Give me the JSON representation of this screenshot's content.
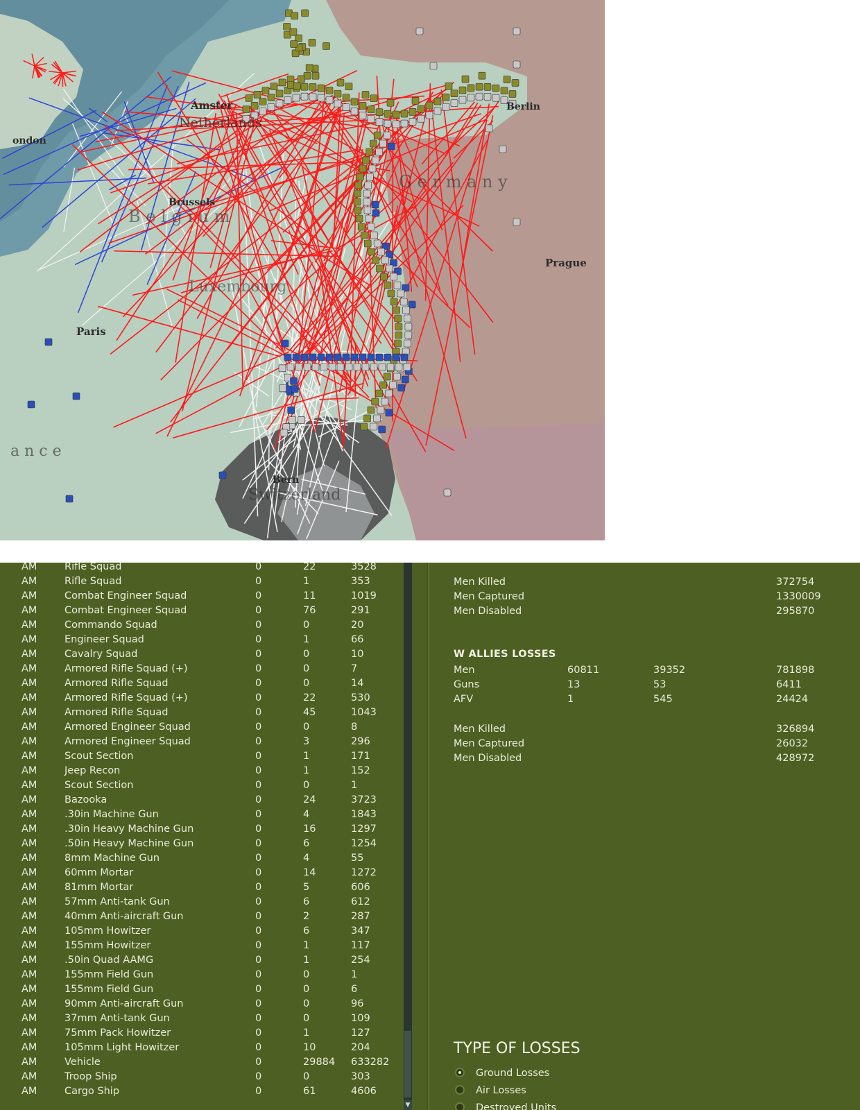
{
  "map": {
    "labels": {
      "amsterdam": "Amster",
      "netherlands": "Netherlands",
      "london": "ondon",
      "berlin": "Berlin",
      "germany": "G e r m a n y",
      "brussels": "Brussels",
      "belgium": "B e l g i u m",
      "prague": "Prague",
      "luxembourg": "Luxembourg",
      "paris": "Paris",
      "france": "a n c e",
      "bern": "Bern",
      "switzerland": "Switzerland"
    },
    "colors": {
      "sea": "#6f9aa8",
      "land_west": "#b9cfc0",
      "land_germany": "#b69a92",
      "switzerland": "#5a5c5c",
      "attack_line": "#ff1a1a",
      "white_line": "#f2f2f2",
      "blue_line": "#2f44d8",
      "allied_unit": "#8a8a2a",
      "axis_unit": "#c8c8c8",
      "blue_unit": "#2a4fb8"
    }
  },
  "units_table": {
    "rows": [
      {
        "nation": "AM",
        "name": "Rifle Squad",
        "a": "0",
        "b": "22",
        "c": "3528"
      },
      {
        "nation": "AM",
        "name": "Rifle Squad",
        "a": "0",
        "b": "1",
        "c": "353"
      },
      {
        "nation": "AM",
        "name": "Combat Engineer Squad",
        "a": "0",
        "b": "11",
        "c": "1019"
      },
      {
        "nation": "AM",
        "name": "Combat Engineer Squad",
        "a": "0",
        "b": "76",
        "c": "291"
      },
      {
        "nation": "AM",
        "name": "Commando Squad",
        "a": "0",
        "b": "0",
        "c": "20"
      },
      {
        "nation": "AM",
        "name": "Engineer Squad",
        "a": "0",
        "b": "1",
        "c": "66"
      },
      {
        "nation": "AM",
        "name": "Cavalry Squad",
        "a": "0",
        "b": "0",
        "c": "10"
      },
      {
        "nation": "AM",
        "name": "Armored Rifle Squad (+)",
        "a": "0",
        "b": "0",
        "c": "7"
      },
      {
        "nation": "AM",
        "name": "Armored Rifle Squad",
        "a": "0",
        "b": "0",
        "c": "14"
      },
      {
        "nation": "AM",
        "name": "Armored Rifle Squad (+)",
        "a": "0",
        "b": "22",
        "c": "530"
      },
      {
        "nation": "AM",
        "name": "Armored Rifle Squad",
        "a": "0",
        "b": "45",
        "c": "1043"
      },
      {
        "nation": "AM",
        "name": "Armored Engineer Squad",
        "a": "0",
        "b": "0",
        "c": "8"
      },
      {
        "nation": "AM",
        "name": "Armored Engineer Squad",
        "a": "0",
        "b": "3",
        "c": "296"
      },
      {
        "nation": "AM",
        "name": "Scout Section",
        "a": "0",
        "b": "1",
        "c": "171"
      },
      {
        "nation": "AM",
        "name": "Jeep Recon",
        "a": "0",
        "b": "1",
        "c": "152"
      },
      {
        "nation": "AM",
        "name": "Scout Section",
        "a": "0",
        "b": "0",
        "c": "1"
      },
      {
        "nation": "AM",
        "name": "Bazooka",
        "a": "0",
        "b": "24",
        "c": "3723"
      },
      {
        "nation": "AM",
        "name": ".30in Machine Gun",
        "a": "0",
        "b": "4",
        "c": "1843"
      },
      {
        "nation": "AM",
        "name": ".30in Heavy Machine Gun",
        "a": "0",
        "b": "16",
        "c": "1297"
      },
      {
        "nation": "AM",
        "name": ".50in Heavy Machine Gun",
        "a": "0",
        "b": "6",
        "c": "1254"
      },
      {
        "nation": "AM",
        "name": "8mm Machine Gun",
        "a": "0",
        "b": "4",
        "c": "55"
      },
      {
        "nation": "AM",
        "name": "60mm Mortar",
        "a": "0",
        "b": "14",
        "c": "1272"
      },
      {
        "nation": "AM",
        "name": "81mm Mortar",
        "a": "0",
        "b": "5",
        "c": "606"
      },
      {
        "nation": "AM",
        "name": "57mm Anti-tank Gun",
        "a": "0",
        "b": "6",
        "c": "612"
      },
      {
        "nation": "AM",
        "name": "40mm Anti-aircraft Gun",
        "a": "0",
        "b": "2",
        "c": "287"
      },
      {
        "nation": "AM",
        "name": "105mm Howitzer",
        "a": "0",
        "b": "6",
        "c": "347"
      },
      {
        "nation": "AM",
        "name": "155mm Howitzer",
        "a": "0",
        "b": "1",
        "c": "117"
      },
      {
        "nation": "AM",
        "name": ".50in Quad AAMG",
        "a": "0",
        "b": "1",
        "c": "254"
      },
      {
        "nation": "AM",
        "name": "155mm Field Gun",
        "a": "0",
        "b": "0",
        "c": "1"
      },
      {
        "nation": "AM",
        "name": "155mm Field Gun",
        "a": "0",
        "b": "0",
        "c": "6"
      },
      {
        "nation": "AM",
        "name": "90mm Anti-aircraft Gun",
        "a": "0",
        "b": "0",
        "c": "96"
      },
      {
        "nation": "AM",
        "name": "37mm Anti-tank Gun",
        "a": "0",
        "b": "0",
        "c": "109"
      },
      {
        "nation": "AM",
        "name": "75mm Pack Howitzer",
        "a": "0",
        "b": "1",
        "c": "127"
      },
      {
        "nation": "AM",
        "name": "105mm Light Howitzer",
        "a": "0",
        "b": "10",
        "c": "204"
      },
      {
        "nation": "AM",
        "name": "Vehicle",
        "a": "0",
        "b": "29884",
        "c": "633282"
      },
      {
        "nation": "AM",
        "name": "Troop Ship",
        "a": "0",
        "b": "0",
        "c": "303"
      },
      {
        "nation": "AM",
        "name": "Cargo Ship",
        "a": "0",
        "b": "61",
        "c": "4606"
      }
    ]
  },
  "axis_summary": {
    "men_killed_label": "Men Killed",
    "men_killed": "372754",
    "men_captured_label": "Men Captured",
    "men_captured": "1330009",
    "men_disabled_label": "Men Disabled",
    "men_disabled": "295870"
  },
  "wallies": {
    "title": "W ALLIES LOSSES",
    "rows": [
      {
        "label": "Men",
        "v1": "60811",
        "v2": "39352",
        "v3": "781898"
      },
      {
        "label": "Guns",
        "v1": "13",
        "v2": "53",
        "v3": "6411"
      },
      {
        "label": "AFV",
        "v1": "1",
        "v2": "545",
        "v3": "24424"
      }
    ],
    "men_killed_label": "Men Killed",
    "men_killed": "326894",
    "men_captured_label": "Men Captured",
    "men_captured": "26032",
    "men_disabled_label": "Men Disabled",
    "men_disabled": "428972"
  },
  "type_of_losses": {
    "title": "TYPE OF LOSSES",
    "options": [
      {
        "label": "Ground Losses",
        "selected": true
      },
      {
        "label": "Air Losses",
        "selected": false
      },
      {
        "label": "Destroyed Units",
        "selected": false
      }
    ]
  },
  "scroll_down_glyph": "▼"
}
